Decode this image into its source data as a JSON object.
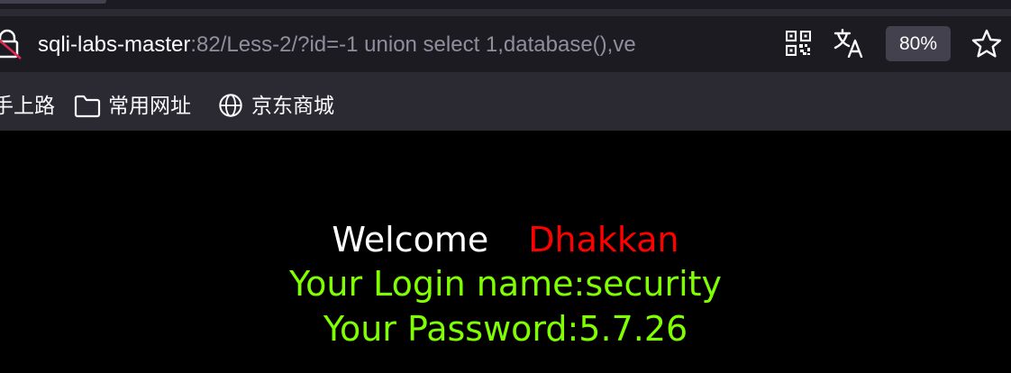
{
  "address_bar": {
    "url_host": "sqli-labs-master",
    "url_rest": ":82/Less-2/?id=-1 union select 1,database(),ve",
    "zoom_level": "80%"
  },
  "bookmarks": {
    "items": [
      {
        "label": "手上路",
        "icon": "none"
      },
      {
        "label": "常用网址",
        "icon": "folder-icon"
      },
      {
        "label": "京东商城",
        "icon": "globe-icon"
      }
    ]
  },
  "page": {
    "welcome_label": "Welcome",
    "user_name": "Dhakkan",
    "login_name_line": "Your Login name:security",
    "password_line": "Your Password:5.7.26"
  },
  "colors": {
    "chrome_bg": "#2b2a33",
    "urlbar_bg": "#1c1b22",
    "page_bg": "#000000",
    "welcome_text": "#ffffff",
    "user_name_text": "#ff0000",
    "result_text": "#7fff00"
  }
}
